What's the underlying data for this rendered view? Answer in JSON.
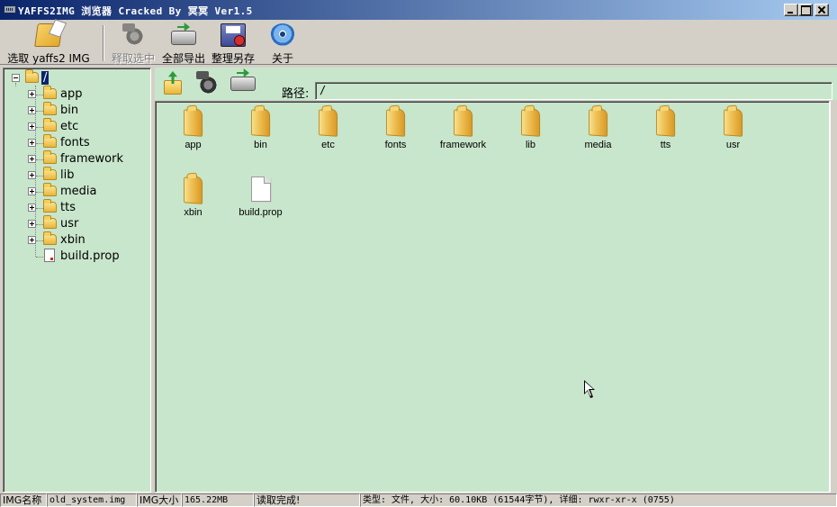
{
  "window": {
    "title": "YAFFS2IMG 浏览器 Cracked By 冥冥 Ver1.5"
  },
  "toolbar": {
    "open_label": "选取 yaffs2 IMG",
    "extract_selected_label": "释取选中",
    "export_all_label": "全部导出",
    "save_as_label": "整理另存",
    "about_label": "关于"
  },
  "tree": {
    "root": "/",
    "items": [
      {
        "label": "app",
        "kind": "folder"
      },
      {
        "label": "bin",
        "kind": "folder"
      },
      {
        "label": "etc",
        "kind": "folder"
      },
      {
        "label": "fonts",
        "kind": "folder"
      },
      {
        "label": "framework",
        "kind": "folder"
      },
      {
        "label": "lib",
        "kind": "folder"
      },
      {
        "label": "media",
        "kind": "folder"
      },
      {
        "label": "tts",
        "kind": "folder"
      },
      {
        "label": "usr",
        "kind": "folder"
      },
      {
        "label": "xbin",
        "kind": "folder"
      },
      {
        "label": "build.prop",
        "kind": "file"
      }
    ]
  },
  "navbar": {
    "path_label": "路径:",
    "path_value": "/"
  },
  "files": [
    {
      "name": "app",
      "kind": "folder"
    },
    {
      "name": "bin",
      "kind": "folder"
    },
    {
      "name": "etc",
      "kind": "folder"
    },
    {
      "name": "fonts",
      "kind": "folder"
    },
    {
      "name": "framework",
      "kind": "folder"
    },
    {
      "name": "lib",
      "kind": "folder"
    },
    {
      "name": "media",
      "kind": "folder"
    },
    {
      "name": "tts",
      "kind": "folder"
    },
    {
      "name": "usr",
      "kind": "folder"
    },
    {
      "name": "xbin",
      "kind": "folder"
    },
    {
      "name": "build.prop",
      "kind": "file"
    }
  ],
  "status": {
    "img_name_label": "IMG名称",
    "img_name_value": "old_system.img",
    "img_size_label": "IMG大小",
    "img_size_value": "165.22MB",
    "message": "读取完成!",
    "detail": "类型: 文件, 大小: 60.10KB (61544字节), 详细: rwxr-xr-x (0755)"
  },
  "icons": {
    "open": "folder-open-icon",
    "extract": "gear-extract-icon",
    "export": "drive-export-icon",
    "save": "disk-save-icon",
    "about": "info-icon",
    "up": "folder-up-icon"
  }
}
